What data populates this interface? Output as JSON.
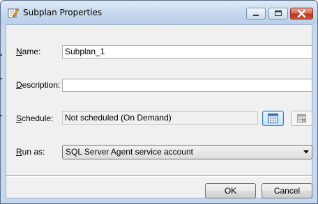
{
  "window": {
    "title": "Subplan Properties",
    "icon": "properties-pencil-icon"
  },
  "form": {
    "name_label": "Name:",
    "name_value": "Subplan_1",
    "description_label": "Description:",
    "description_value": "",
    "schedule_label": "Schedule:",
    "schedule_value": "Not scheduled (On Demand)",
    "runas_label": "Run as:",
    "runas_value": "SQL Server Agent service account"
  },
  "buttons": {
    "ok": "OK",
    "cancel": "Cancel"
  },
  "colors": {
    "titlebar": "#c9dbf0",
    "close_button": "#c7533b",
    "dialog_face": "#f0f0f0"
  }
}
